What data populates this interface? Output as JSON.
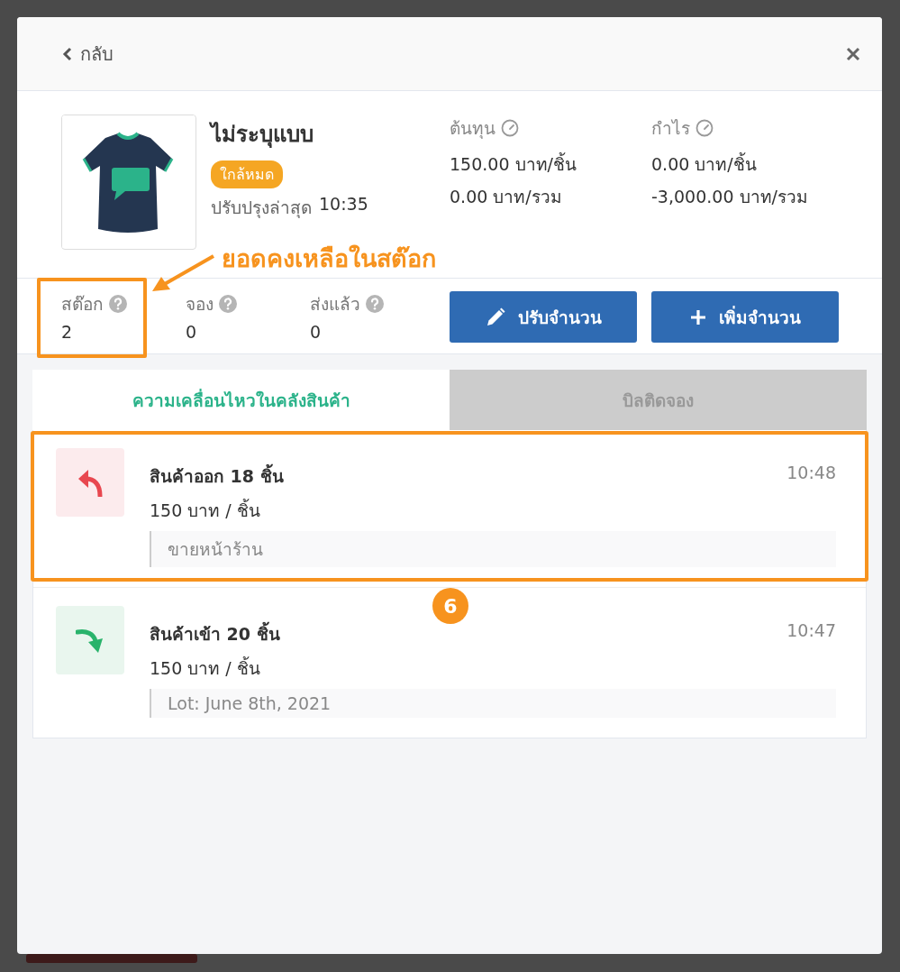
{
  "header": {
    "back": "กลับ"
  },
  "product": {
    "name": "ไม่ระบุแบบ",
    "badge": "ใกล้หมด",
    "updated_label": "ปรับปรุงล่าสุด",
    "updated_time": "10:35",
    "figures": [
      {
        "label": "ต้นทุน",
        "per_unit": "150.00 บาท/ชิ้น",
        "total": "0.00 บาท/รวม"
      },
      {
        "label": "กำไร",
        "per_unit": "0.00 บาท/ชิ้น",
        "total": "-3,000.00 บาท/รวม"
      }
    ]
  },
  "callout": "ยอดคงเหลือในสต๊อก",
  "stats": [
    {
      "label": "สต๊อก",
      "value": "2",
      "highlighted": true
    },
    {
      "label": "จอง",
      "value": "0",
      "highlighted": false
    },
    {
      "label": "ส่งแล้ว",
      "value": "0",
      "highlighted": false
    }
  ],
  "buttons": [
    {
      "kind": "edit",
      "label": "ปรับจำนวน"
    },
    {
      "kind": "add",
      "label": "เพิ่มจำนวน"
    }
  ],
  "tabs": [
    {
      "label": "ความเคลื่อนไหวในคลังสินค้า",
      "selected": true
    },
    {
      "label": "บิลติดจอง",
      "selected": false
    }
  ],
  "movements": [
    {
      "kind": "out",
      "title": "สินค้าออก 18 ชิ้น",
      "price": "150 บาท / ชิ้น",
      "note": "ขายหน้าร้าน",
      "time": "10:48",
      "highlighted": true
    },
    {
      "kind": "in",
      "title": "สินค้าเข้า 20 ชิ้น",
      "price": "150 บาท / ชิ้น",
      "note": "Lot: June 8th, 2021",
      "time": "10:47",
      "highlighted": false
    }
  ],
  "step_badge": "6"
}
